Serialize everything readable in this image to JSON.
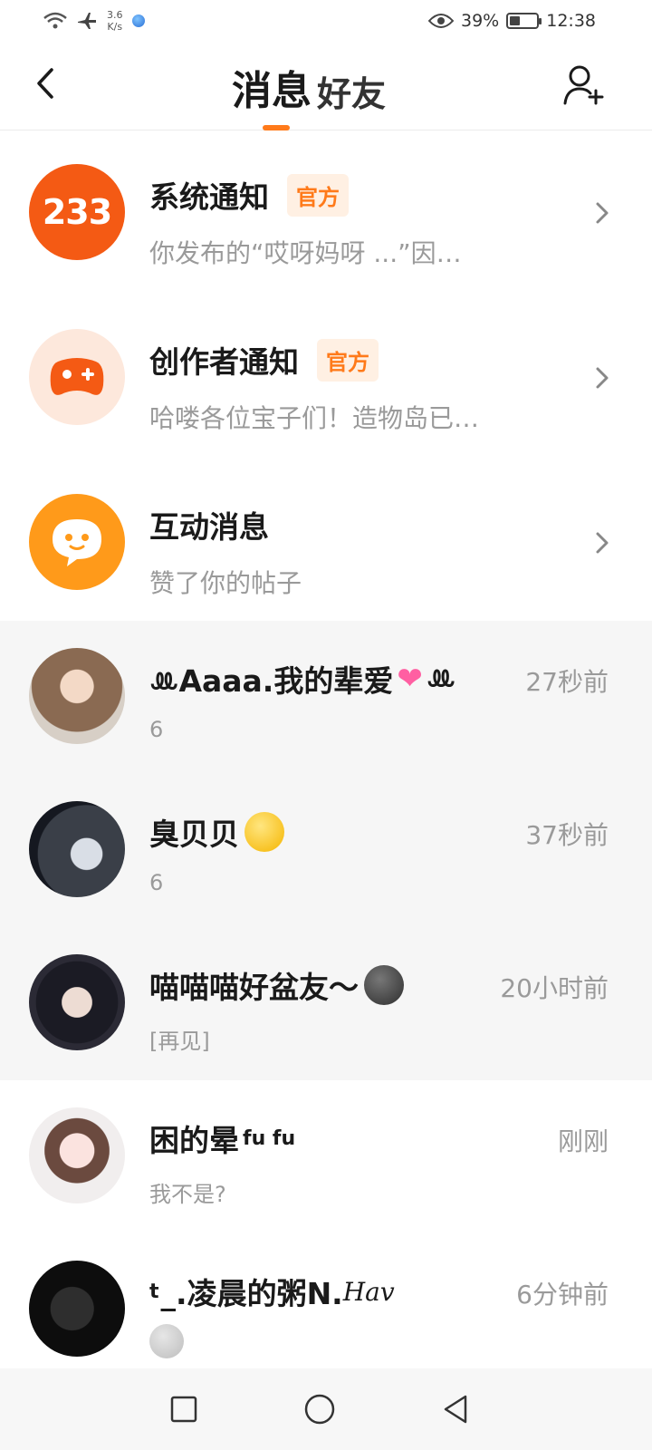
{
  "status_bar": {
    "speed_value": "3.6",
    "speed_unit": "K/s",
    "battery": "39%",
    "battery_level": 0.39,
    "time": "12:38"
  },
  "header": {
    "tab_messages": "消息",
    "tab_friends": "好友"
  },
  "notifications": [
    {
      "title": "系统通知",
      "badge": "官方",
      "preview": "你发布的“哎呀妈呀 ...”因…",
      "avatar_text": "233"
    },
    {
      "title": "创作者通知",
      "badge": "官方",
      "preview": "哈喽各位宝子们！造物岛已…"
    },
    {
      "title": "互动消息",
      "preview": "赞了你的帖子"
    }
  ],
  "chats": [
    {
      "name_pre": "ꔛAaaa.我的辈爱",
      "name_post": "ꔛ",
      "time": "27秒前",
      "preview": "6"
    },
    {
      "name": "臭贝贝",
      "time": "37秒前",
      "preview": "6"
    },
    {
      "name": "喵喵喵好盆友～",
      "time": "20小时前",
      "preview": "[再见]"
    },
    {
      "name": "困的晕",
      "name_sup": "fu fu",
      "time": "刚刚",
      "preview": "我不是?"
    },
    {
      "name_sup_pre": "t",
      "name": "_.凌晨的粥N.",
      "name_script": "Hav",
      "time": "6分钟前"
    }
  ],
  "colors": {
    "accent": "#ff7a1a",
    "badge_bg": "#fff0e3",
    "muted_text": "#9a9a9a",
    "shaded_row": "#f6f6f6"
  },
  "icons": {
    "back": "back-arrow-icon",
    "add_friend": "add-friend-icon",
    "chevron": "chevron-right-icon",
    "nav_recent": "square-icon",
    "nav_home": "circle-icon",
    "nav_back": "triangle-back-icon"
  }
}
